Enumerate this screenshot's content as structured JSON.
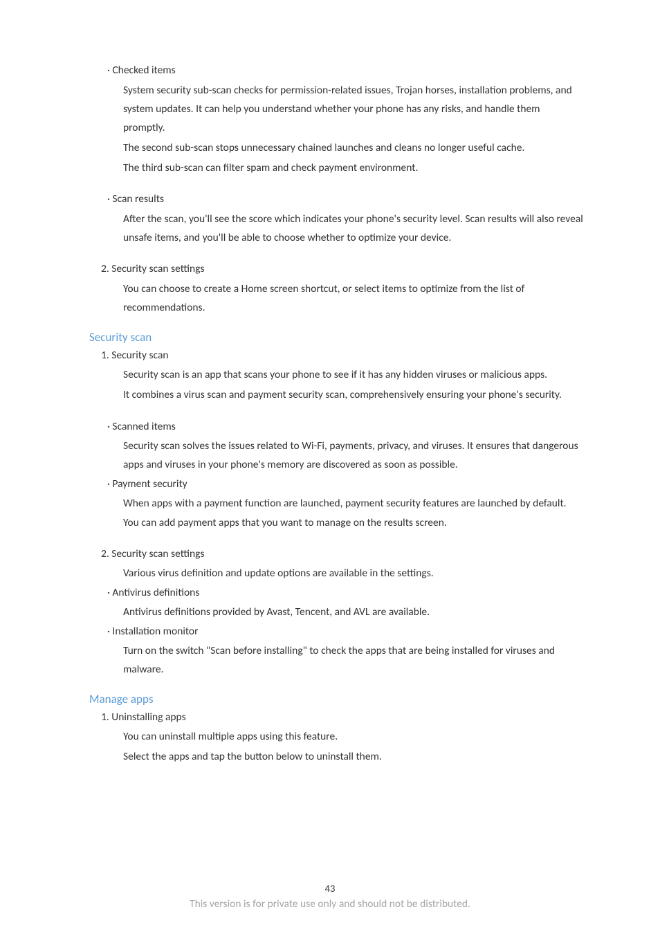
{
  "sec1": {
    "checked_items_label": "· Checked items",
    "checked_p1": "System security sub-scan checks for permission-related issues, Trojan horses, installation problems, and system updates. It can help you understand whether your phone has any risks, and handle them promptly.",
    "checked_p2": "The second sub-scan stops unnecessary chained launches and cleans no longer useful cache.",
    "checked_p3": "The third sub-scan can filter spam and check payment environment.",
    "scan_results_label": "· Scan results",
    "scan_results_p1": "After the scan, you'll see the score which indicates your phone's security level. Scan results will also reveal unsafe items, and you'll be able to choose whether to optimize your device.",
    "settings_label": "2. Security scan settings",
    "settings_p1": "You can choose to create a Home screen shortcut, or select items to optimize from the list of recommendations."
  },
  "sec2": {
    "heading": "Security scan",
    "item1_label": "1. Security scan",
    "item1_p1": "Security scan is an app that scans your phone to see if it has any hidden viruses or malicious apps.",
    "item1_p2": "It combines a virus scan and payment security scan, comprehensively ensuring your phone's security.",
    "scanned_label": "· Scanned items",
    "scanned_p1": "Security scan solves the issues related to Wi-Fi, payments, privacy, and viruses. It ensures that dangerous apps and viruses in your phone's memory are discovered as soon as possible.",
    "payment_label": "· Payment security",
    "payment_p1": "When apps with a payment function are launched, payment security features are launched by default. You can add payment apps that you want to manage on the results screen.",
    "item2_label": "2. Security scan settings",
    "item2_p1": "Various virus definition and update options are available in the settings.",
    "antivirus_label": "· Antivirus definitions",
    "antivirus_p1": "Antivirus definitions provided by Avast, Tencent, and AVL are available.",
    "install_label": "· Installation monitor",
    "install_p1": "Turn on the switch \"Scan before installing\" to check the apps that are being installed for viruses and malware."
  },
  "sec3": {
    "heading": "Manage apps",
    "item1_label": "1. Uninstalling apps",
    "item1_p1": "You can uninstall multiple apps using this feature.",
    "item1_p2": "Select the apps and tap the button below to uninstall them."
  },
  "footer": {
    "page_number": "43",
    "note": "This version is for private use only and should not be distributed."
  }
}
